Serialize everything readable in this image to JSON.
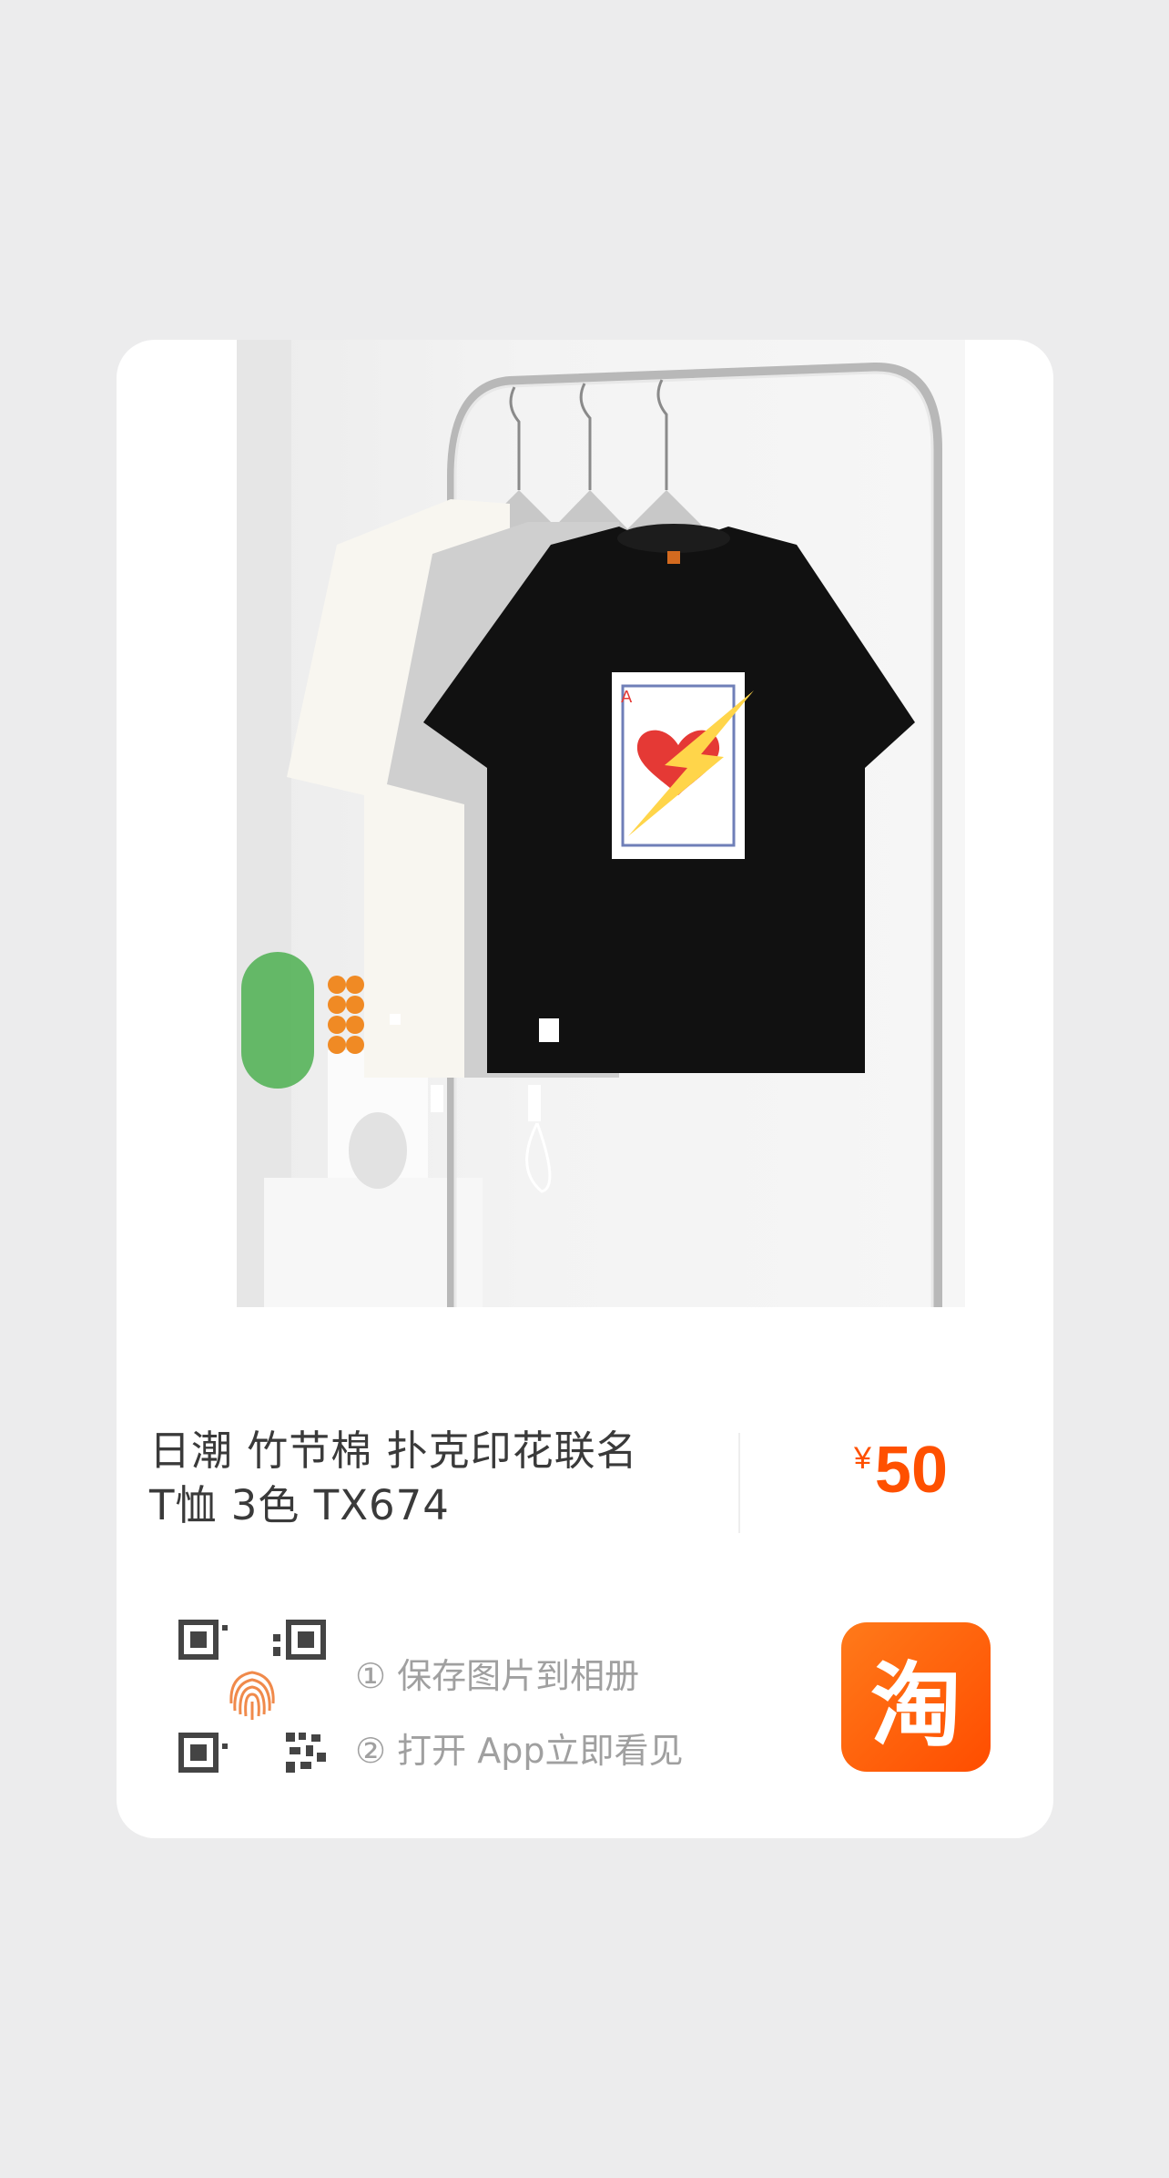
{
  "product": {
    "title_line1": "日潮 竹节棉 扑克印花联名",
    "title_line2": "T恤 3色 TX674",
    "currency": "¥",
    "price": "50"
  },
  "instructions": {
    "step1": "① 保存图片到相册",
    "step2": "② 打开 App立即看见"
  },
  "app_icon": {
    "glyph": "淘",
    "color": "#ff5000"
  },
  "icons": {
    "qr": "qr-code-icon",
    "fingerprint": "fingerprint-icon",
    "app": "taobao-app-icon"
  }
}
